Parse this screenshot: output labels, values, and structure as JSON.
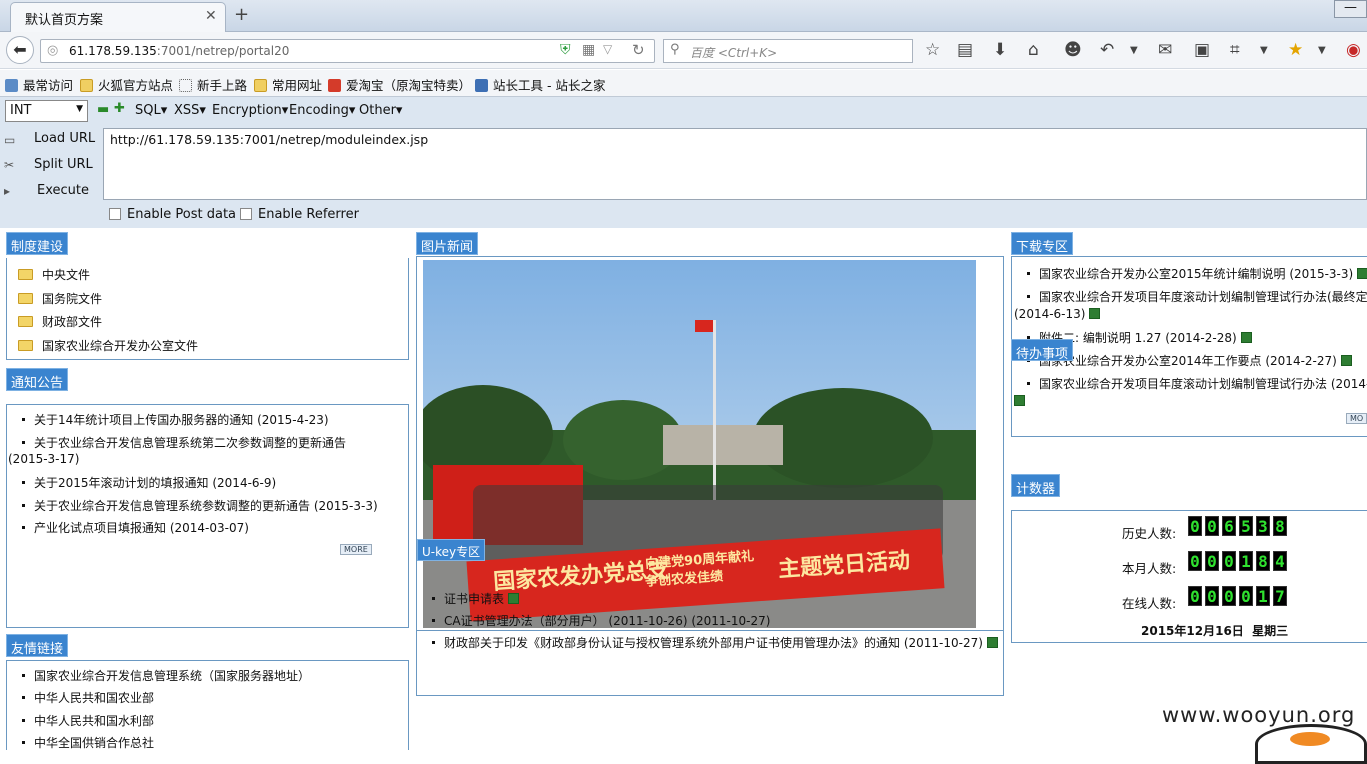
{
  "tab": {
    "title": "默认首页方案"
  },
  "nav": {
    "url_host": "61.178.59.135",
    "url_path": ":7001/netrep/portal20",
    "search_placeholder": "百度 <Ctrl+K>"
  },
  "bookmarks": [
    {
      "label": "最常访问",
      "icon": "bookmark-icon"
    },
    {
      "label": "火狐官方站点",
      "icon": "folder-icon"
    },
    {
      "label": "新手上路",
      "icon": "dotted-icon"
    },
    {
      "label": "常用网址",
      "icon": "folder-icon"
    },
    {
      "label": "爱淘宝（原淘宝特卖）",
      "icon": "taobao-icon"
    },
    {
      "label": "站长工具 - 站长之家",
      "icon": "chinaz-icon"
    }
  ],
  "hackbar": {
    "select_value": "INT",
    "menus": [
      "SQL▾",
      "XSS▾",
      "Encryption▾",
      "Encoding▾",
      "Other▾"
    ],
    "buttons": [
      "Load URL",
      "Split URL",
      "Execute"
    ],
    "url_text": "http://61.178.59.135:7001/netrep/moduleindex.jsp",
    "checkbox_post": "Enable Post data",
    "checkbox_referrer": "Enable Referrer"
  },
  "zhidu": {
    "title": "制度建设",
    "items": [
      "中央文件",
      "国务院文件",
      "财政部文件",
      "国家农业综合开发办公室文件"
    ]
  },
  "tongzhi": {
    "title": "通知公告",
    "items": [
      "关于14年统计项目上传国办服务器的通知 (2015-4-23)",
      "关于农业综合开发信息管理系统第二次参数调整的更新通告",
      "(2015-3-17)",
      "关于2015年滚动计划的填报通知 (2014-6-9)",
      "关于农业综合开发信息管理系统参数调整的更新通告 (2015-3-3)",
      "产业化试点项目填报通知 (2014-03-07)"
    ],
    "more": "MORE"
  },
  "youqing": {
    "title": "友情链接",
    "items": [
      "国家农业综合开发信息管理系统（国家服务器地址）",
      "中华人民共和国农业部",
      "中华人民共和国水利部",
      "中华全国供销合作总社"
    ]
  },
  "tupian": {
    "title": "图片新闻",
    "banner": "国家农发办党总支",
    "banner2a": "向建党90周年献礼",
    "banner2b": "争创农发佳绩",
    "banner3": "主题党日活动"
  },
  "ukey": {
    "title": "U-key专区",
    "items": [
      "证书申请表",
      "CA证书管理办法（部分用户） (2011-10-26) (2011-10-27)",
      "财政部关于印发《财政部身份认证与授权管理系统外部用户证书使用管理办法》的通知 (2011-10-27)"
    ]
  },
  "xiazai": {
    "title": "下载专区",
    "items": [
      "国家农业综合开发办公室2015年统计编制说明 (2015-3-3)",
      "国家农业综合开发项目年度滚动计划编制管理试行办法(最终定",
      "(2014-6-13)",
      "附件二: 编制说明 1.27 (2014-2-28)",
      "国家农业综合开发办公室2014年工作要点 (2014-2-27)",
      "国家农业综合开发项目年度滚动计划编制管理试行办法 (2014-"
    ],
    "more": "MO"
  },
  "daiban": {
    "title": "待办事项"
  },
  "jishu": {
    "title": "计数器",
    "rows": [
      {
        "label": "历史人数:",
        "digits": [
          "0",
          "0",
          "6",
          "5",
          "3",
          "8"
        ]
      },
      {
        "label": "本月人数:",
        "digits": [
          "0",
          "0",
          "0",
          "1",
          "8",
          "4"
        ]
      },
      {
        "label": "在线人数:",
        "digits": [
          "0",
          "0",
          "0",
          "0",
          "1",
          "7"
        ]
      }
    ],
    "date": "2015年12月16日  星期三"
  },
  "watermark": "www.wooyun.org",
  "colors": {
    "section_header": "#3a84cf",
    "counter_digit": "#2fe22f",
    "banner_red": "#d7261e"
  }
}
